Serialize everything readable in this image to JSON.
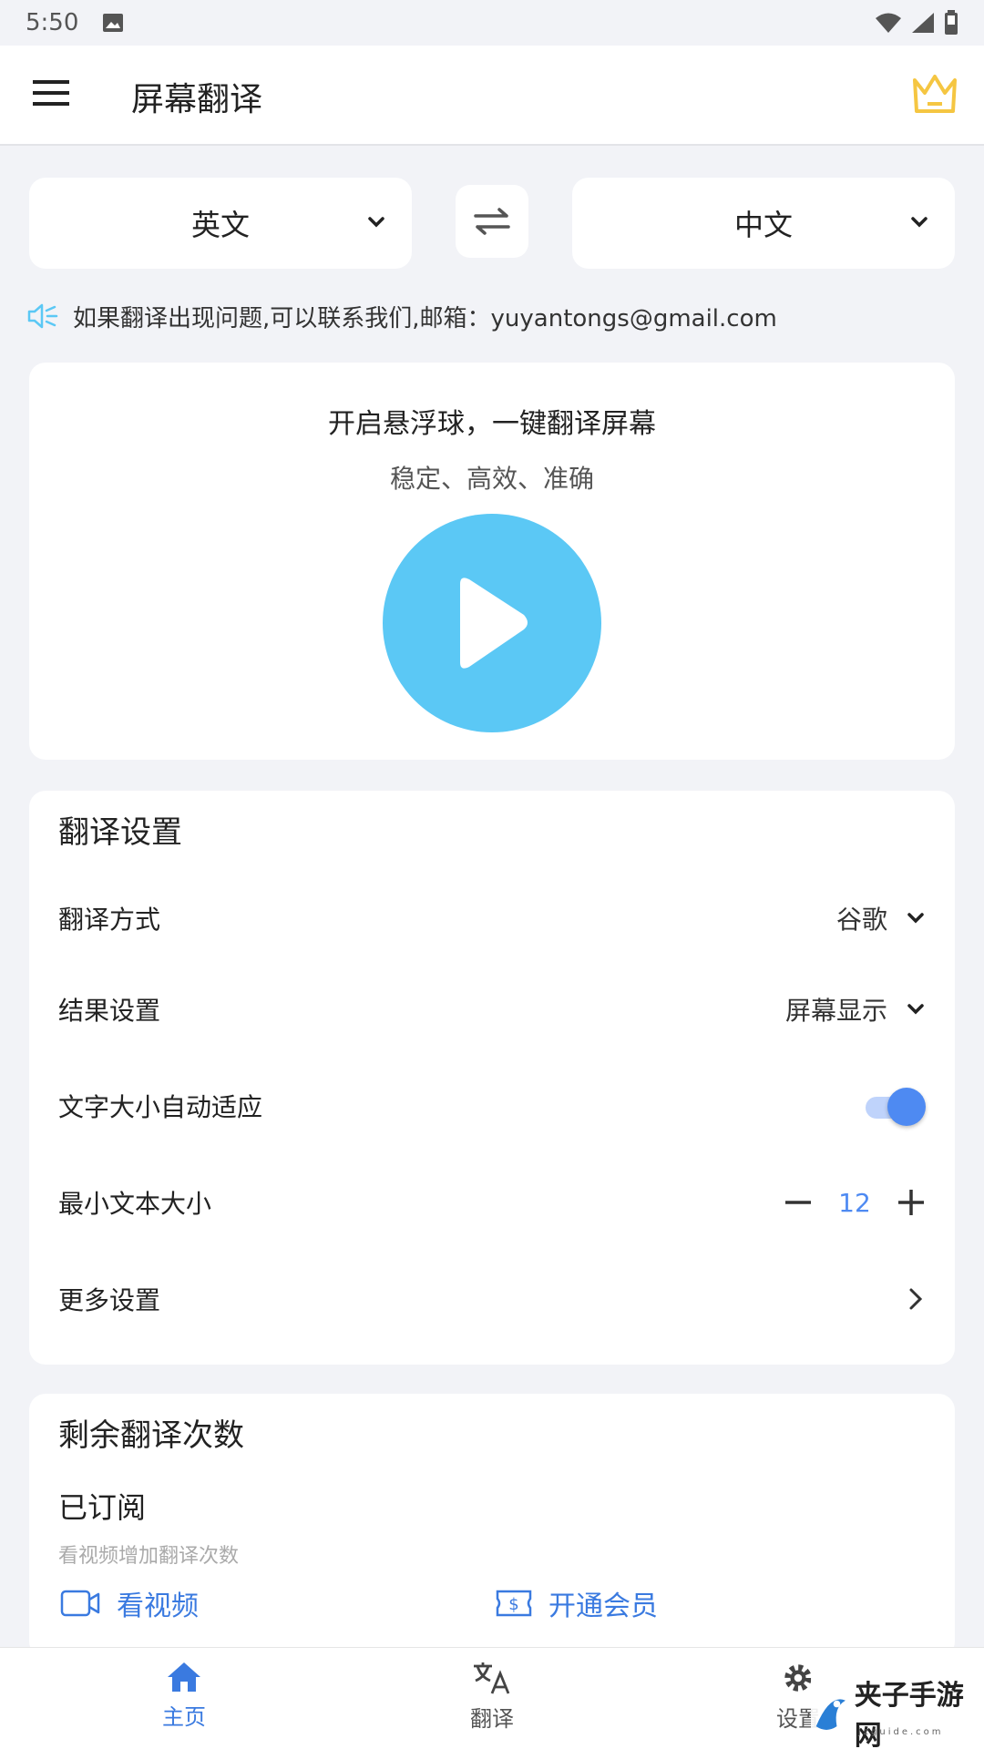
{
  "status_bar": {
    "time": "5:50"
  },
  "app_bar": {
    "title": "屏幕翻译"
  },
  "languages": {
    "source": "英文",
    "target": "中文"
  },
  "notice": {
    "text": "如果翻译出现问题,可以联系我们,邮箱：yuyantongs@gmail.com"
  },
  "hero": {
    "title": "开启悬浮球，一键翻译屏幕",
    "subtitle": "稳定、高效、准确"
  },
  "settings": {
    "title": "翻译设置",
    "method_label": "翻译方式",
    "method_value": "谷歌",
    "result_label": "结果设置",
    "result_value": "屏幕显示",
    "autosize_label": "文字大小自动适应",
    "autosize_on": true,
    "min_size_label": "最小文本大小",
    "min_size_value": "12",
    "more_label": "更多设置"
  },
  "quota": {
    "title": "剩余翻译次数",
    "status": "已订阅",
    "hint": "看视频增加翻译次数",
    "watch_video": "看视频",
    "membership": "开通会员"
  },
  "bottom_nav": {
    "home": "主页",
    "translate": "翻译",
    "settings": "设置"
  },
  "watermark": {
    "text": "夹子手游网",
    "domain": "jzguide.com"
  },
  "colors": {
    "accent": "#3a7ae0",
    "play": "#5bc8f5",
    "crown": "#f5c642",
    "toggle": "#4e8af2"
  }
}
